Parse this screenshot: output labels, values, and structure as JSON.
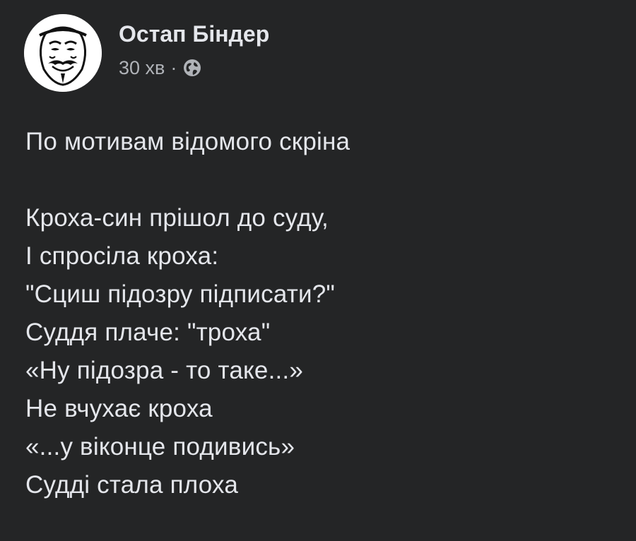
{
  "post": {
    "author": "Остап Біндер",
    "time": "30 хв",
    "separator": "·",
    "privacy_icon": "globe-icon",
    "avatar_icon": "guy-fawkes-mask-avatar",
    "intro": "По мотивам відомого скріна",
    "poem": [
      "Кроха-син прішол до суду,",
      "І спросіла кроха:",
      "\"Сциш підозру підписати?\"",
      "Суддя плаче: \"троха\"",
      "«Ну підозра - то таке...»",
      "Не вчухає кроха",
      "«...у віконце подивись»",
      "Судді стала плоха"
    ]
  },
  "colors": {
    "background": "#242526",
    "primary_text": "#e4e6eb",
    "secondary_text": "#b0b3b8"
  }
}
